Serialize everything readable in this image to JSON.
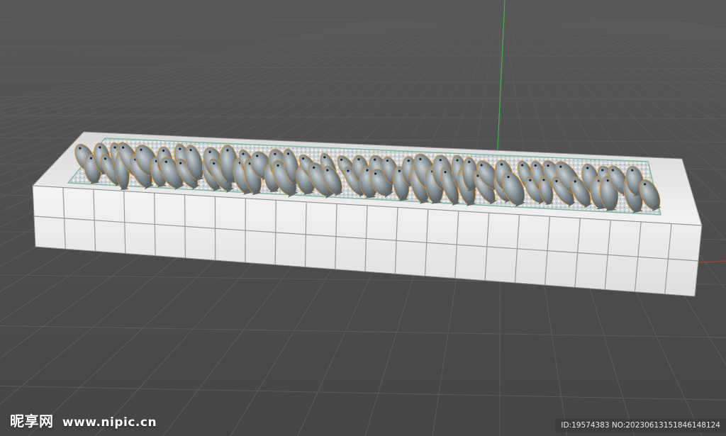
{
  "scene": {
    "background_color": "#4b4b4b",
    "grid_line_color": "#5c5c5c",
    "axis_y_color": "#3fb24a",
    "axis_x_color": "#c0392b",
    "tile_color": "#f1f1f1",
    "tile_grout_color": "#9a9a9a",
    "ice_color": "#d9dde0",
    "fish_color": "#7d8a8f",
    "fish_highlight_color": "#b9c4c7",
    "selection_outline_color": "#e0902a",
    "rim_glass_color": "#7fb9a6"
  },
  "objects": {
    "fish_display_counter": "tiled-counter",
    "fish_count_visible": 70
  },
  "watermark": {
    "brand": "昵享网",
    "site": "www.nipic.cn",
    "id_text": "ID:19574383 NO:20230613151846148124"
  }
}
